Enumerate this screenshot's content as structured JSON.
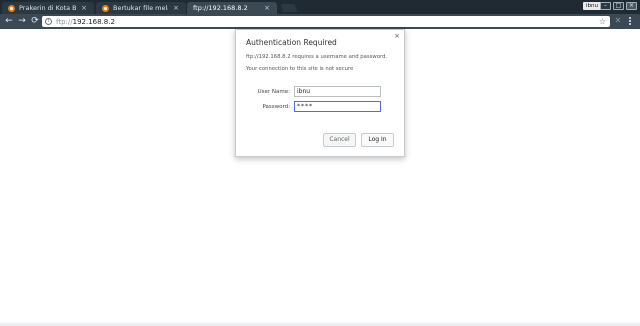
{
  "tabs": [
    {
      "label": "Prakerin di Kota Bersih",
      "active": false
    },
    {
      "label": "Bertukar file melalui ja",
      "active": false
    },
    {
      "label": "ftp://192.168.8.2",
      "active": true
    }
  ],
  "tab_close_glyph": "×",
  "profile_label": "ibnu",
  "window_controls": {
    "minimize": "–",
    "maximize": "□",
    "close": "×"
  },
  "toolbar": {
    "back": "←",
    "forward": "→",
    "reload": "⟳",
    "url_scheme": "ftp://",
    "url_host": "192.168.8.2",
    "star": "☆",
    "stop": "✕"
  },
  "dialog": {
    "title": "Authentication Required",
    "message_line1": "ftp://192.168.8.2 requires a username and password.",
    "message_line2": "Your connection to this site is not secure",
    "username_label": "User Name:",
    "username_value": "ibnu",
    "password_label": "Password:",
    "password_value": "****",
    "cancel_label": "Cancel",
    "login_label": "Log In",
    "close_glyph": "×"
  },
  "colors": {
    "tab_strip": "#1f2a33",
    "toolbar": "#3a4954",
    "favicon": "#f57d00",
    "focus_border": "#4d6fe0"
  },
  "icons": [
    "back-arrow-icon",
    "forward-arrow-icon",
    "reload-icon",
    "info-icon",
    "star-icon",
    "menu-icon"
  ]
}
